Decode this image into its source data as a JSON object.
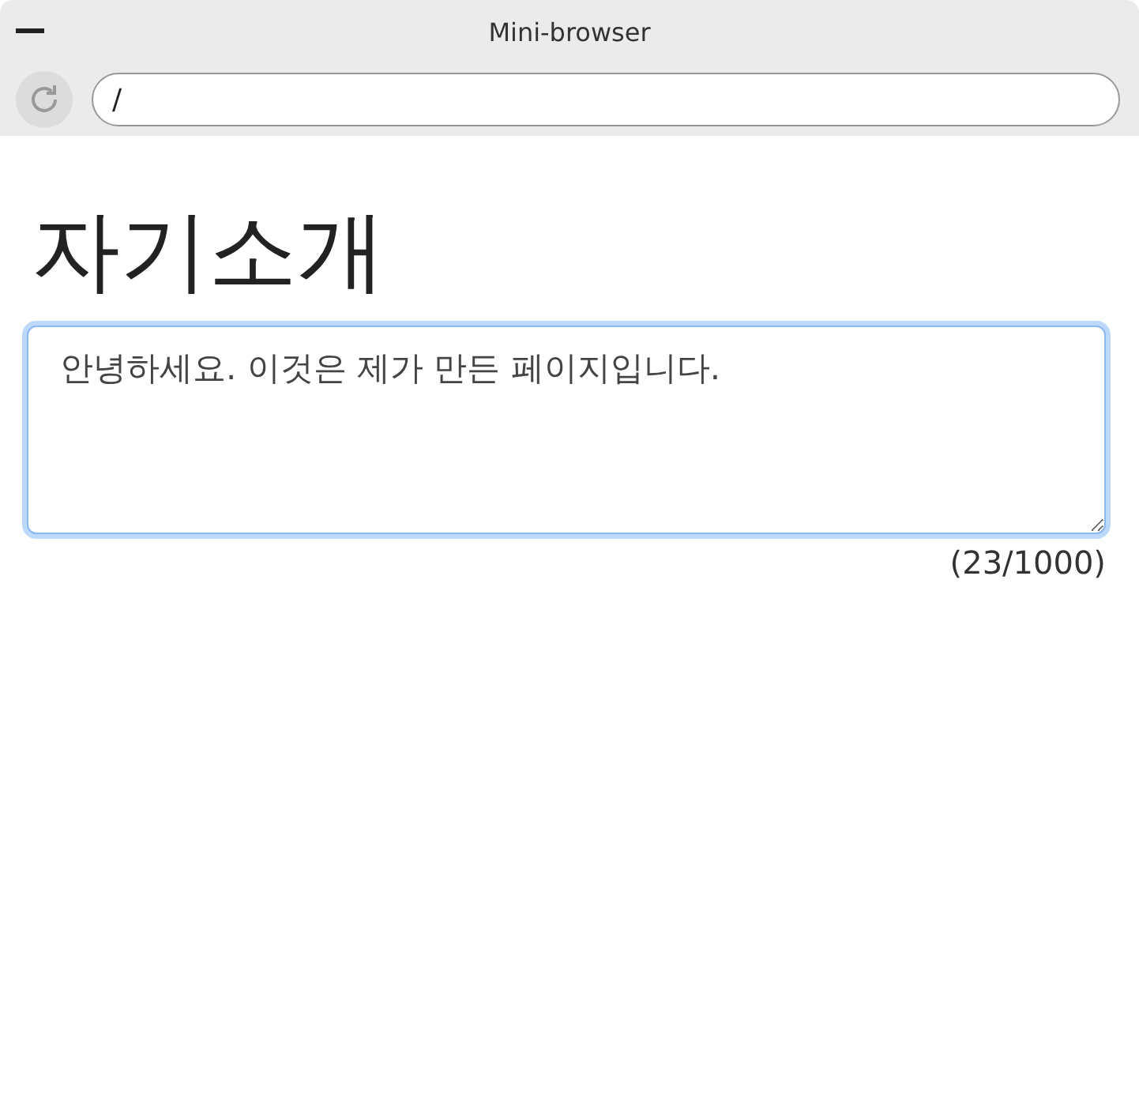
{
  "window": {
    "title": "Mini-browser"
  },
  "toolbar": {
    "address": {
      "value": "/"
    }
  },
  "page": {
    "heading": "자기소개",
    "textarea": {
      "value": "안녕하세요. 이것은 제가 만든 페이지입니다.",
      "focused": true
    },
    "counter": "(23/1000)"
  }
}
